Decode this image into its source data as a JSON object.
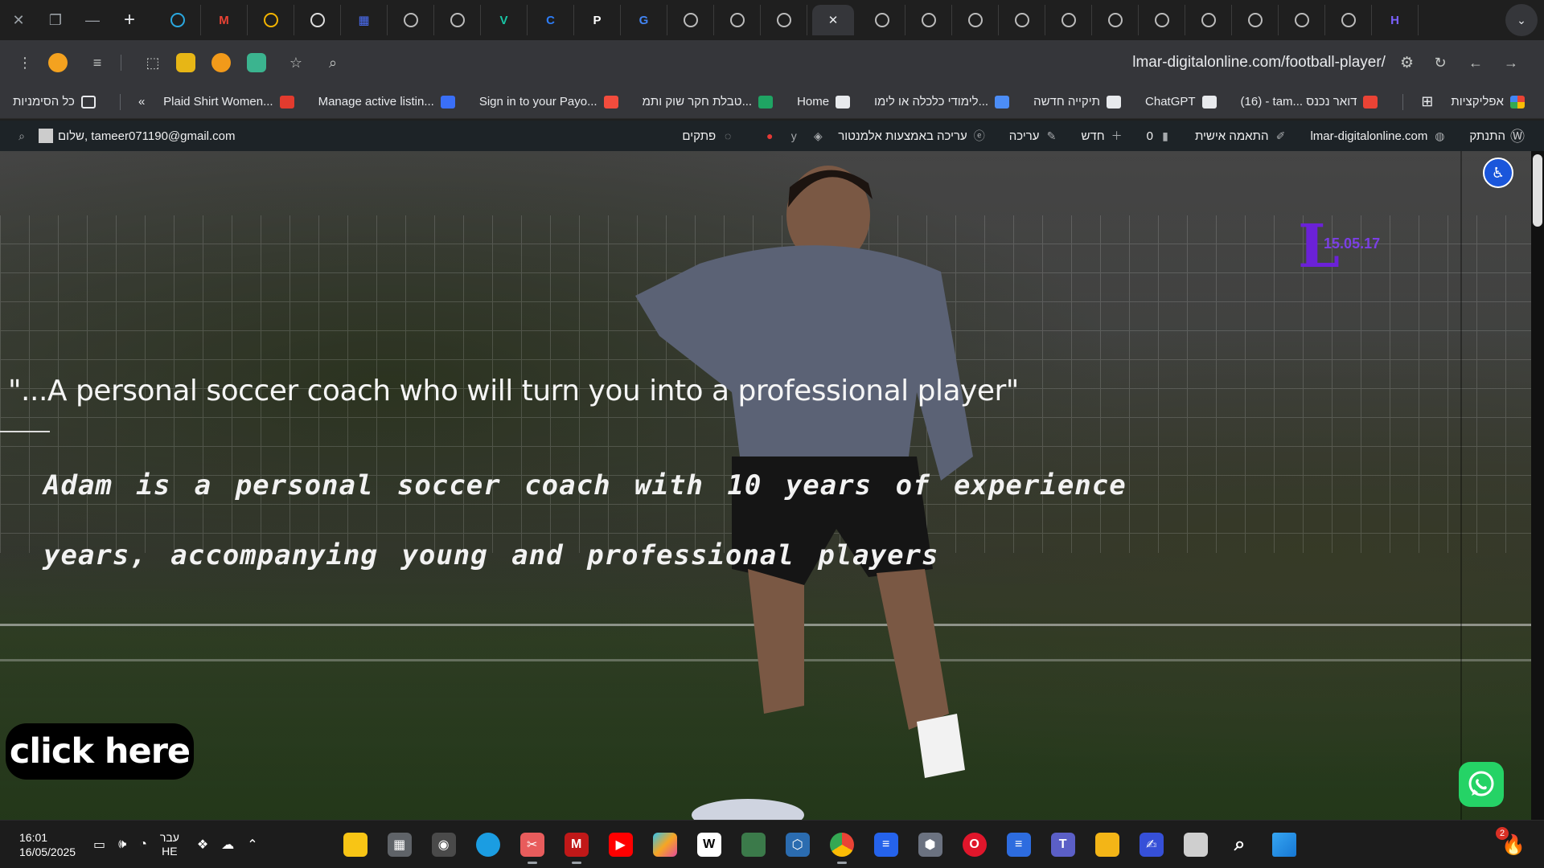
{
  "browser": {
    "tabs": [
      {
        "icon": "windows-icon",
        "color": "#2aa8e0"
      },
      {
        "icon": "gmail-icon",
        "color": "#ea4335"
      },
      {
        "icon": "colorful-swirl-icon",
        "color": "#f4b400"
      },
      {
        "icon": "chatgpt-icon",
        "color": "#dddddd"
      },
      {
        "icon": "calendar-icon",
        "color": "#4b6ef5"
      },
      {
        "icon": "chrome-globe-icon",
        "color": "#bbbbbb"
      },
      {
        "icon": "chrome-globe-icon",
        "color": "#bbbbbb"
      },
      {
        "icon": "v-logo-icon",
        "color": "#18c5a5"
      },
      {
        "icon": "canva-icon",
        "color": "#2d7cf6"
      },
      {
        "icon": "p-logo-icon",
        "color": "#ffffff"
      },
      {
        "icon": "google-icon",
        "color": "#4285f4"
      },
      {
        "icon": "globe-icon",
        "color": "#bbbbbb"
      },
      {
        "icon": "globe-icon",
        "color": "#bbbbbb"
      },
      {
        "icon": "globe-icon",
        "color": "#bbbbbb"
      },
      {
        "icon": "close-icon",
        "color": "#e8eaed",
        "active": true
      },
      {
        "icon": "globe-icon",
        "color": "#bbbbbb"
      },
      {
        "icon": "globe-icon",
        "color": "#bbbbbb"
      },
      {
        "icon": "globe-icon",
        "color": "#bbbbbb"
      },
      {
        "icon": "globe-icon",
        "color": "#bbbbbb"
      },
      {
        "icon": "globe-icon",
        "color": "#bbbbbb"
      },
      {
        "icon": "globe-icon",
        "color": "#bbbbbb"
      },
      {
        "icon": "globe-icon",
        "color": "#bbbbbb"
      },
      {
        "icon": "globe-icon",
        "color": "#bbbbbb"
      },
      {
        "icon": "globe-icon",
        "color": "#bbbbbb"
      },
      {
        "icon": "globe-icon",
        "color": "#bbbbbb"
      },
      {
        "icon": "globe-icon",
        "color": "#bbbbbb"
      },
      {
        "icon": "h-logo-icon",
        "color": "#7b61ff"
      }
    ],
    "url": "lmar-digitalonline.com/football-player/"
  },
  "bookmarks": {
    "all_bookmarks": "כל הסימניות",
    "items": [
      {
        "label": "Plaid Shirt Women...",
        "icon_color": "#e23b2e"
      },
      {
        "label": "Manage active listin...",
        "icon_color": "#3a6ff7"
      },
      {
        "label": "Sign in to your Payo...",
        "icon_color": "#f24c3d"
      },
      {
        "label": "טבלת חקר שוק ותמ...",
        "icon_color": "#1fa463"
      },
      {
        "label": "Home",
        "icon_color": "#e8eaed"
      },
      {
        "label": "לימודי כלכלה או לימו...",
        "icon_color": "#4c8df6"
      },
      {
        "label": "תיקייה חדשה",
        "icon_color": "#e8eaed"
      },
      {
        "label": "ChatGPT",
        "icon_color": "#e8eaed"
      },
      {
        "label": "(16) - tam... דואר נכנס",
        "icon_color": "#ea4335"
      }
    ],
    "apps": "אפליקציות"
  },
  "adminbar": {
    "greeting": "שלום, tameer071190@gmail.com",
    "site": "lmar-digitalonline.com",
    "customize": "התאמה אישית",
    "comments_count": "0",
    "new": "חדש",
    "edit": "עריכה",
    "elementor": "עריכה באמצעות אלמנטור",
    "snippets": "פתקים",
    "wp_howto": "התנתק"
  },
  "hero": {
    "logo_letter": "L",
    "logo_date": "15.05.17",
    "quote": "\"...A personal soccer coach who will turn you into a professional player\"",
    "line1": "Adam is a personal soccer coach with 10 years of experience",
    "line2": "years, accompanying young and professional players",
    "cta": "click here"
  },
  "taskbar": {
    "time": "16:01",
    "date": "16/05/2025",
    "lang_top": "עבר",
    "lang_bottom": "HE",
    "widget_badge": "2"
  }
}
